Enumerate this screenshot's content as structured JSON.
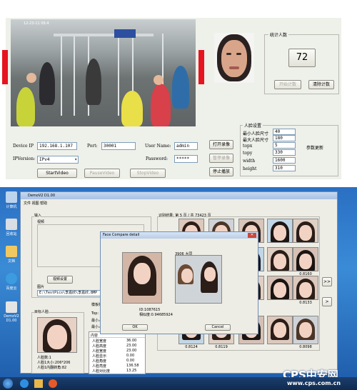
{
  "top": {
    "stats_group_label": "统计人数",
    "count_value": "72",
    "start_count": "开始计数",
    "clear_count": "清除计数",
    "timestamp": "12-23-11 06:4",
    "device_ip_label": "Device IP",
    "device_ip_value": "192.168.1.107",
    "port_label": "Port:",
    "port_value": "30001",
    "username_label": "User Name:",
    "username_value": "admin",
    "ipversion_label": "IPVersion:",
    "ipversion_value": "IPv4",
    "password_label": "Password:",
    "password_value": "*****",
    "start_video": "StartVideo",
    "pause_video": "PauseVideo",
    "stop_video": "StopVideo",
    "open_record": "打开录像",
    "pause_btn": "暂停录像",
    "stop_play": "停止播放",
    "face_settings_label": "人脸设置",
    "min_face_label": "最小人脸尺寸",
    "min_face_value": "40",
    "max_face_label": "最大人脸尺寸",
    "max_face_value": "180",
    "topx_label": "topx",
    "topx_value": "5",
    "topy_label": "topy",
    "topy_value": "330",
    "width_label": "width",
    "width_value": "1600",
    "height_label": "height",
    "height_value": "310",
    "param_update": "参数更新"
  },
  "desk": {
    "app_title": "DemoV2 D1.00",
    "menu": "文件  视图  帮助",
    "input_group": "输入",
    "video_label": "视频",
    "video_settings": "视频设置",
    "image_label": "图片",
    "image_path": "E:\\TestPics\\李嘉欣\\李嘉欣.BMP",
    "target_face_label": "目标人脸",
    "face_number": "人脸数:1",
    "face_size": "人脸1大小:206*206",
    "face_angle": "人脸1内翻转角:82",
    "results_label": "识别结果: 第 5 页 / 共 73423 页",
    "template_label": "模板样",
    "top_label": "Top:",
    "min_label": "最小人",
    "min_label2": "最小人",
    "content_header": "内容",
    "table_rows": [
      {
        "k": "人脸宽度",
        "v": "36.00"
      },
      {
        "k": "人脸高度",
        "v": "23.00"
      },
      {
        "k": "人脸宽度",
        "v": "23.00"
      },
      {
        "k": "人脸显示",
        "v": "0.00"
      },
      {
        "k": "人脸角度",
        "v": "0.00"
      },
      {
        "k": "人脸亮度",
        "v": "136.58"
      },
      {
        "k": "人脸对比度",
        "v": "13.25"
      }
    ],
    "scores_row1": [
      "",
      "",
      "",
      "0.9435",
      "",
      ""
    ],
    "scores_row2": [
      "",
      "",
      "",
      "0.8237",
      "",
      "0.8160"
    ],
    "scores_row3": [
      "",
      "",
      "",
      "0.8143",
      "",
      "0.8133"
    ],
    "scores_row4": [
      "0.8124",
      "0.8119",
      "",
      "0.8098",
      "",
      "0.8098"
    ],
    "next_btn": ">>",
    "prev_btn": ">",
    "dialog_title": "Face Compare detail",
    "dialog_img_caption": "3906 大同",
    "dialog_id": "ID:1087615",
    "dialog_score": "相似度:0.94685924",
    "ok": "OK",
    "cancel": "Cancel",
    "icons": [
      "计算机",
      "回收站",
      "文档",
      "百度云",
      "DemoV2 D1.00"
    ],
    "watermark_brand": "CPS中安网",
    "watermark_url": "www.cps.com.cn"
  }
}
